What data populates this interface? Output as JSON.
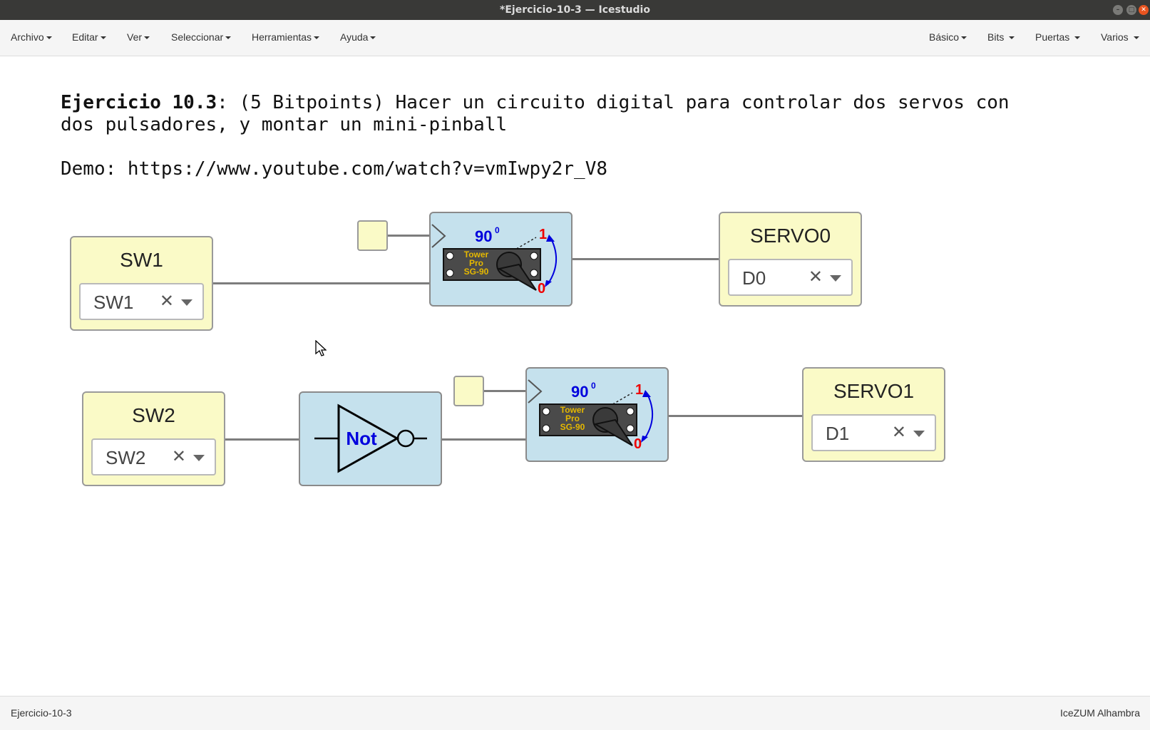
{
  "window": {
    "title": "*Ejercicio-10-3 — Icestudio"
  },
  "menu_left": [
    "Archivo",
    "Editar",
    "Ver",
    "Seleccionar",
    "Herramientas",
    "Ayuda"
  ],
  "menu_right": [
    "Básico",
    "Bits",
    "Puertas",
    "Varios"
  ],
  "note": {
    "bold": "Ejercicio 10.3",
    "line1": ": (5 Bitpoints) Hacer un circuito digital para controlar dos servos con",
    "line2": "dos pulsadores, y montar un mini-pinball",
    "line3": "Demo: https://www.youtube.com/watch?v=vmIwpy2r_V8"
  },
  "inputs": [
    {
      "name": "SW1",
      "pin": "SW1"
    },
    {
      "name": "SW2",
      "pin": "SW2"
    }
  ],
  "outputs": [
    {
      "name": "SERVO0",
      "pin": "D0"
    },
    {
      "name": "SERVO1",
      "pin": "D1"
    }
  ],
  "servo": {
    "angle": "90",
    "angle_unit": "0",
    "high": "1",
    "low": "0",
    "label1": "Tower",
    "label2": "Pro",
    "label3": "SG-90"
  },
  "not_gate": {
    "label": "Not"
  },
  "status": {
    "left": "Ejercicio-10-3",
    "right": "IceZUM Alhambra"
  },
  "colors": {
    "input_block": "#fafac7",
    "code_block": "#c5e1ed",
    "accent": "#e95420"
  }
}
